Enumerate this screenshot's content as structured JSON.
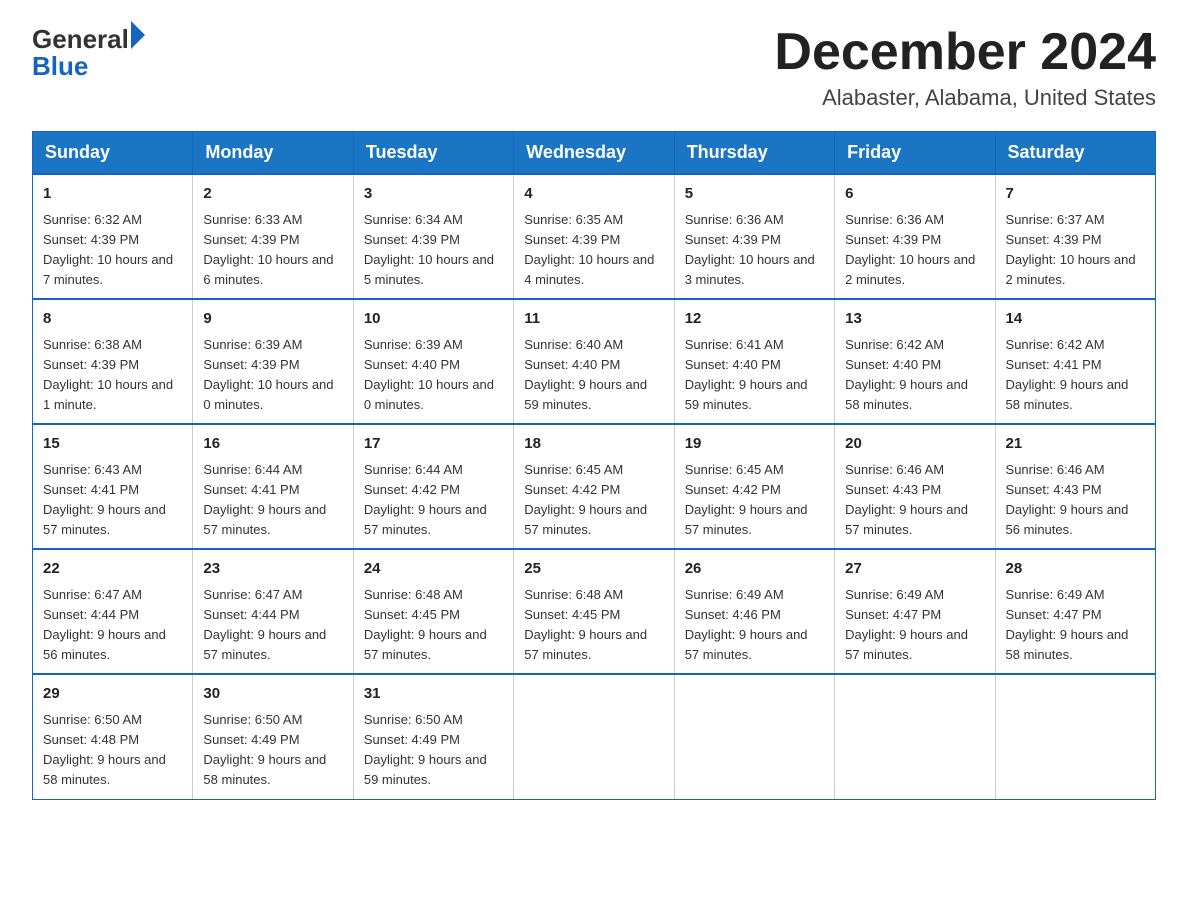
{
  "header": {
    "logo_general": "General",
    "logo_blue": "Blue",
    "month_title": "December 2024",
    "location": "Alabaster, Alabama, United States"
  },
  "weekdays": [
    "Sunday",
    "Monday",
    "Tuesday",
    "Wednesday",
    "Thursday",
    "Friday",
    "Saturday"
  ],
  "weeks": [
    [
      {
        "day": "1",
        "sunrise": "6:32 AM",
        "sunset": "4:39 PM",
        "daylight": "10 hours and 7 minutes."
      },
      {
        "day": "2",
        "sunrise": "6:33 AM",
        "sunset": "4:39 PM",
        "daylight": "10 hours and 6 minutes."
      },
      {
        "day": "3",
        "sunrise": "6:34 AM",
        "sunset": "4:39 PM",
        "daylight": "10 hours and 5 minutes."
      },
      {
        "day": "4",
        "sunrise": "6:35 AM",
        "sunset": "4:39 PM",
        "daylight": "10 hours and 4 minutes."
      },
      {
        "day": "5",
        "sunrise": "6:36 AM",
        "sunset": "4:39 PM",
        "daylight": "10 hours and 3 minutes."
      },
      {
        "day": "6",
        "sunrise": "6:36 AM",
        "sunset": "4:39 PM",
        "daylight": "10 hours and 2 minutes."
      },
      {
        "day": "7",
        "sunrise": "6:37 AM",
        "sunset": "4:39 PM",
        "daylight": "10 hours and 2 minutes."
      }
    ],
    [
      {
        "day": "8",
        "sunrise": "6:38 AM",
        "sunset": "4:39 PM",
        "daylight": "10 hours and 1 minute."
      },
      {
        "day": "9",
        "sunrise": "6:39 AM",
        "sunset": "4:39 PM",
        "daylight": "10 hours and 0 minutes."
      },
      {
        "day": "10",
        "sunrise": "6:39 AM",
        "sunset": "4:40 PM",
        "daylight": "10 hours and 0 minutes."
      },
      {
        "day": "11",
        "sunrise": "6:40 AM",
        "sunset": "4:40 PM",
        "daylight": "9 hours and 59 minutes."
      },
      {
        "day": "12",
        "sunrise": "6:41 AM",
        "sunset": "4:40 PM",
        "daylight": "9 hours and 59 minutes."
      },
      {
        "day": "13",
        "sunrise": "6:42 AM",
        "sunset": "4:40 PM",
        "daylight": "9 hours and 58 minutes."
      },
      {
        "day": "14",
        "sunrise": "6:42 AM",
        "sunset": "4:41 PM",
        "daylight": "9 hours and 58 minutes."
      }
    ],
    [
      {
        "day": "15",
        "sunrise": "6:43 AM",
        "sunset": "4:41 PM",
        "daylight": "9 hours and 57 minutes."
      },
      {
        "day": "16",
        "sunrise": "6:44 AM",
        "sunset": "4:41 PM",
        "daylight": "9 hours and 57 minutes."
      },
      {
        "day": "17",
        "sunrise": "6:44 AM",
        "sunset": "4:42 PM",
        "daylight": "9 hours and 57 minutes."
      },
      {
        "day": "18",
        "sunrise": "6:45 AM",
        "sunset": "4:42 PM",
        "daylight": "9 hours and 57 minutes."
      },
      {
        "day": "19",
        "sunrise": "6:45 AM",
        "sunset": "4:42 PM",
        "daylight": "9 hours and 57 minutes."
      },
      {
        "day": "20",
        "sunrise": "6:46 AM",
        "sunset": "4:43 PM",
        "daylight": "9 hours and 57 minutes."
      },
      {
        "day": "21",
        "sunrise": "6:46 AM",
        "sunset": "4:43 PM",
        "daylight": "9 hours and 56 minutes."
      }
    ],
    [
      {
        "day": "22",
        "sunrise": "6:47 AM",
        "sunset": "4:44 PM",
        "daylight": "9 hours and 56 minutes."
      },
      {
        "day": "23",
        "sunrise": "6:47 AM",
        "sunset": "4:44 PM",
        "daylight": "9 hours and 57 minutes."
      },
      {
        "day": "24",
        "sunrise": "6:48 AM",
        "sunset": "4:45 PM",
        "daylight": "9 hours and 57 minutes."
      },
      {
        "day": "25",
        "sunrise": "6:48 AM",
        "sunset": "4:45 PM",
        "daylight": "9 hours and 57 minutes."
      },
      {
        "day": "26",
        "sunrise": "6:49 AM",
        "sunset": "4:46 PM",
        "daylight": "9 hours and 57 minutes."
      },
      {
        "day": "27",
        "sunrise": "6:49 AM",
        "sunset": "4:47 PM",
        "daylight": "9 hours and 57 minutes."
      },
      {
        "day": "28",
        "sunrise": "6:49 AM",
        "sunset": "4:47 PM",
        "daylight": "9 hours and 58 minutes."
      }
    ],
    [
      {
        "day": "29",
        "sunrise": "6:50 AM",
        "sunset": "4:48 PM",
        "daylight": "9 hours and 58 minutes."
      },
      {
        "day": "30",
        "sunrise": "6:50 AM",
        "sunset": "4:49 PM",
        "daylight": "9 hours and 58 minutes."
      },
      {
        "day": "31",
        "sunrise": "6:50 AM",
        "sunset": "4:49 PM",
        "daylight": "9 hours and 59 minutes."
      },
      null,
      null,
      null,
      null
    ]
  ],
  "labels": {
    "sunrise": "Sunrise:",
    "sunset": "Sunset:",
    "daylight": "Daylight:"
  }
}
